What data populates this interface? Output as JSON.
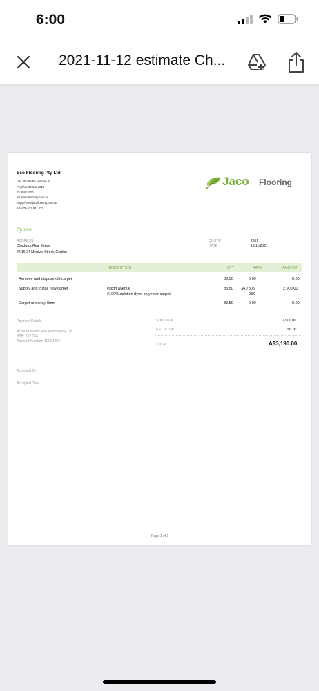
{
  "status": {
    "time": "6:00"
  },
  "topbar": {
    "title": "2021-11-12 estimate Ch..."
  },
  "doc": {
    "company": {
      "name": "Eco Flooring Pty Ltd",
      "lines": [
        "Unit 20 / 55-59 Norman St",
        "Peakhurst NSW  2210",
        "02 95812620",
        "info@ecoflooring.com.au",
        "https://www.jacoflooring.com.au",
        "ABN 70 623 811 423"
      ]
    },
    "logo": {
      "brand": "Jaco",
      "word": "Flooring",
      "color": "#7bb03c"
    },
    "quote_label": "Quote",
    "address_label": "ADDRESS",
    "address_lines": [
      "Chadwick Real Estate",
      "27/16-24 Merriwa Street, Gordon"
    ],
    "quote_no_label": "QUOTE",
    "quote_no": "2651",
    "date_label": "DATE",
    "date": "12/11/2021",
    "table": {
      "headers": {
        "description": "DESCRIPTION",
        "qty": "QTY",
        "rate": "RATE",
        "amount": "AMOUNT"
      },
      "rows": [
        {
          "item": "Remove and dispose old carpet",
          "desc1": "",
          "desc2": "",
          "qty": "83.50",
          "rate": "0.00",
          "rate2": "",
          "amount": "0.00"
        },
        {
          "item": "Supply and install new carpet",
          "desc1": "#sixth avenue",
          "desc2": "#100% solution dyed polyester carpet",
          "qty": "83.50",
          "rate": "34.7305",
          "rate2": "389",
          "amount": "2,900.00"
        },
        {
          "item": "Carpet underlay-8mm",
          "desc1": "",
          "desc2": "",
          "qty": "83.50",
          "rate": "0.00",
          "rate2": "",
          "amount": "0.00"
        }
      ]
    },
    "payment": {
      "label": "Payment Details",
      "lines": [
        "Account Name: Eco Flooring Pty Ltd",
        "BSB: 062 184",
        "Account Number: 1159 1821"
      ]
    },
    "totals": {
      "subtotal_label": "SUBTOTAL",
      "subtotal": "2,900.00",
      "gst_label": "GST TOTAL",
      "gst": "290.00",
      "total_label": "TOTAL",
      "total": "A$3,190.00"
    },
    "accepted_by": "Accepted By",
    "accepted_date": "Accepted Date",
    "page_num": "Page 1 of 1"
  }
}
